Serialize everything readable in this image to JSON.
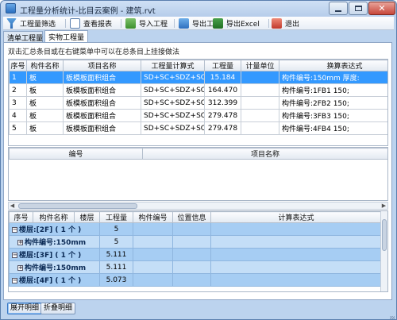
{
  "window": {
    "title": "工程量分析统计-比目云案例 - 建筑.rvt"
  },
  "toolbar": {
    "items": [
      {
        "label": "工程量筛选",
        "icon": "filter-icon"
      },
      {
        "label": "查看报表",
        "icon": "report-icon"
      },
      {
        "label": "导入工程",
        "icon": "import-icon"
      },
      {
        "label": "导出工程",
        "icon": "export-icon"
      },
      {
        "label": "导出Excel",
        "icon": "excel-icon"
      },
      {
        "label": "退出",
        "icon": "exit-icon"
      }
    ]
  },
  "tabs": [
    {
      "label": "清单工程量"
    },
    {
      "label": "实物工程量",
      "active": true
    }
  ],
  "hint": "双击汇总条目或在右键菜单中可以在总条目上挂接做法",
  "summary_table": {
    "headers": [
      "序号",
      "构件名称",
      "项目名称",
      "工程量计算式",
      "工程量",
      "计量单位",
      "换算表达式"
    ],
    "rows": [
      [
        "1",
        "板",
        "板模板面积组合",
        "SD+SC+SDZ+SC",
        "15.184",
        "",
        "构件编号:150mm 厚度:"
      ],
      [
        "2",
        "板",
        "板模板面积组合",
        "SD+SC+SDZ+SC",
        "164.470",
        "",
        "构件编号:1FB1 150;"
      ],
      [
        "3",
        "板",
        "板模板面积组合",
        "SD+SC+SDZ+SC",
        "312.399",
        "",
        "构件编号:2FB2 150;"
      ],
      [
        "4",
        "板",
        "板模板面积组合",
        "SD+SC+SDZ+SC",
        "279.478",
        "",
        "构件编号:3FB3 150;"
      ],
      [
        "5",
        "板",
        "板模板面积组合",
        "SD+SC+SDZ+SC",
        "279.478",
        "",
        "构件编号:4FB4 150;"
      ]
    ],
    "selected_row": 1
  },
  "method_table": {
    "headers": [
      "编号",
      "项目名称"
    ]
  },
  "detail_table": {
    "headers": [
      "序号",
      "构件名称",
      "楼层",
      "工程量",
      "构件编号",
      "位置信息",
      "计算表达式"
    ],
    "rows": [
      {
        "label": "楼层:[2F] ( 1 个 )",
        "quantity": "5",
        "kind": "group"
      },
      {
        "label": "构件编号:150mm",
        "quantity": "5",
        "kind": "sub"
      },
      {
        "label": "楼层:[3F] ( 1 个 )",
        "quantity": "5.111",
        "kind": "group"
      },
      {
        "label": "构件编号:150mm",
        "quantity": "5.111",
        "kind": "sub"
      },
      {
        "label": "楼层:[4F] ( 1 个 )",
        "quantity": "5.073",
        "kind": "group"
      }
    ]
  },
  "buttons": {
    "expand": "展开明细",
    "collapse": "折叠明细"
  },
  "colors": {
    "selection": "#3399ff",
    "detail_row": "#a6cdf3",
    "title_bar": "#bcd3ee"
  }
}
